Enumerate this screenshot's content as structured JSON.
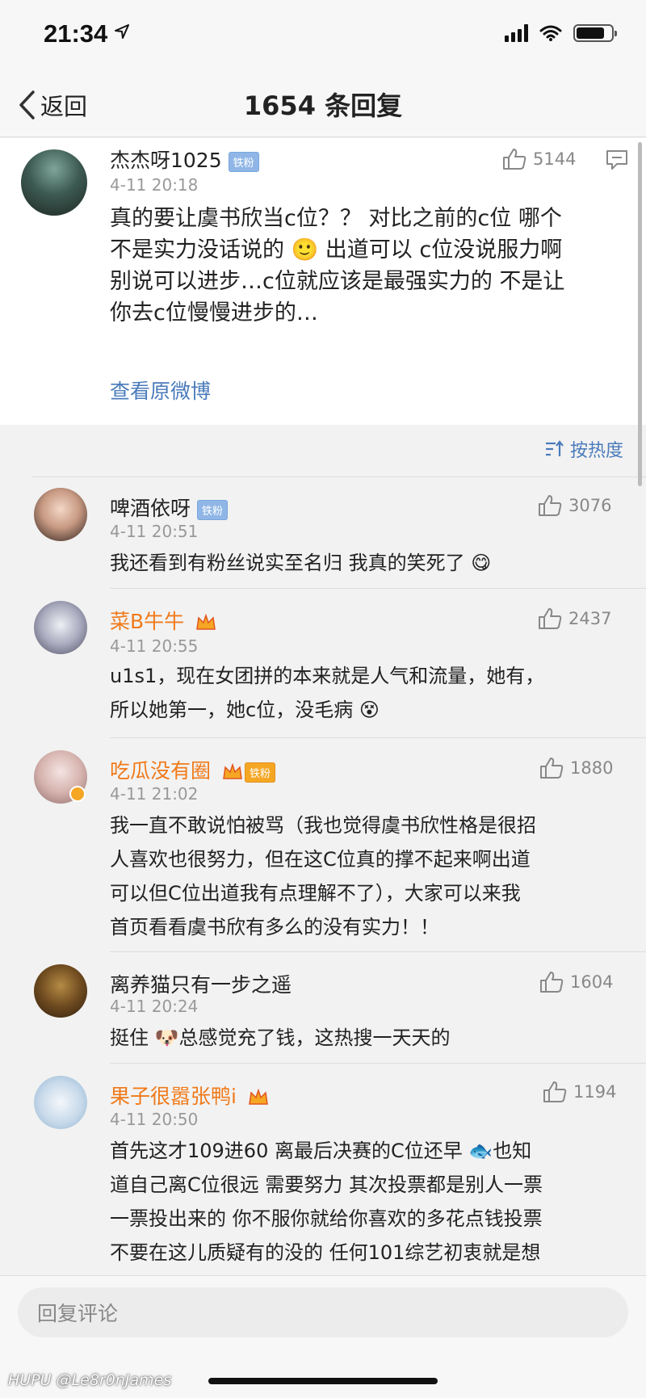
{
  "status_bar": {
    "time": "21:34"
  },
  "nav": {
    "back_label": "返回",
    "title": "1654 条回复"
  },
  "main_comment": {
    "username": "杰杰呀1025",
    "badge": "铁粉",
    "time": "4-11 20:18",
    "likes": "5144",
    "text_lines": [
      "真的要让虞书欣当c位？？ 对比之前的c位 哪个",
      "不是实力没话说的 🙂 出道可以 c位没说服力啊",
      "别说可以进步…c位就应该是最强实力的 不是让",
      "你去c位慢慢进步的…"
    ],
    "view_original": "查看原微博"
  },
  "sort": {
    "label": "按热度"
  },
  "replies": [
    {
      "username": "啤酒依呀",
      "badge": "铁粉",
      "time": "4-11 20:51",
      "likes": "3076",
      "text_lines": [
        "我还看到有粉丝说实至名归 我真的笑死了 😋"
      ]
    },
    {
      "username": "菜B牛牛",
      "time": "4-11 20:55",
      "likes": "2437",
      "text_lines": [
        "u1s1，现在女团拼的本来就是人气和流量，她有，",
        "所以她第一，她c位，没毛病 😵"
      ]
    },
    {
      "username": "吃瓜没有圈",
      "badge": "铁粉",
      "time": "4-11 21:02",
      "likes": "1880",
      "text_lines": [
        "我一直不敢说怕被骂（我也觉得虞书欣性格是很招",
        "人喜欢也很努力，但在这C位真的撑不起来啊出道",
        "可以但C位出道我有点理解不了），大家可以来我",
        "首页看看虞书欣有多么的没有实力！！"
      ]
    },
    {
      "username": "离养猫只有一步之遥",
      "time": "4-11 20:24",
      "likes": "1604",
      "text_lines": [
        "挺住 🐶总感觉充了钱，这热搜一天天的"
      ]
    },
    {
      "username": "果子很嚣张鸭i",
      "time": "4-11 20:50",
      "likes": "1194",
      "text_lines": [
        "首先这才109进60 离最后决赛的C位还早 🐟也知",
        "道自己离C位很远 需要努力 其次投票都是别人一票",
        "一票投出来的 你不服你就给你喜欢的多花点钱投票",
        "不要在这儿质疑有的没的 任何101综艺初衷就是想"
      ]
    }
  ],
  "input": {
    "placeholder": "回复评论"
  },
  "watermark": "HUPU @Le8r0nJames",
  "colors": {
    "vip_name": "#f07a1a",
    "link": "#4a7bbb",
    "badge": "#8fb6e6"
  }
}
